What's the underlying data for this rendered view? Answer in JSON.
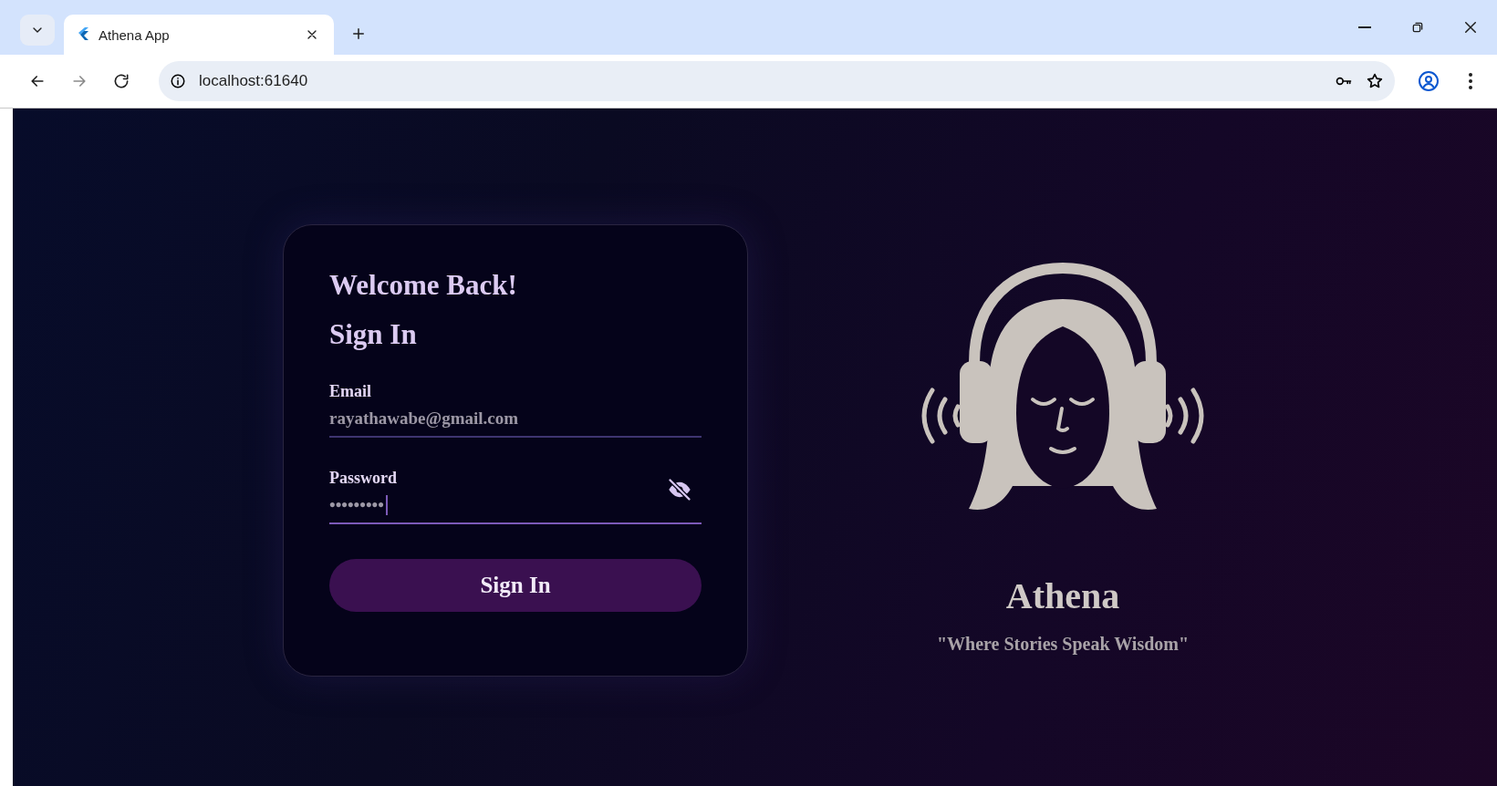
{
  "browser": {
    "tab": {
      "title": "Athena App",
      "selected": true
    },
    "address": "localhost:61640"
  },
  "login": {
    "heading": "Welcome Back!",
    "subheading": "Sign In",
    "fields": [
      {
        "kind": "email",
        "label": "Email",
        "value": "rayathawabe@gmail.com",
        "focused": false
      },
      {
        "kind": "password",
        "label": "Password",
        "value": "•••••••••",
        "focused": true,
        "visible": false
      }
    ],
    "button": "Sign In"
  },
  "brand": {
    "name": "Athena",
    "tagline": "\"Where Stories Speak Wisdom\""
  }
}
